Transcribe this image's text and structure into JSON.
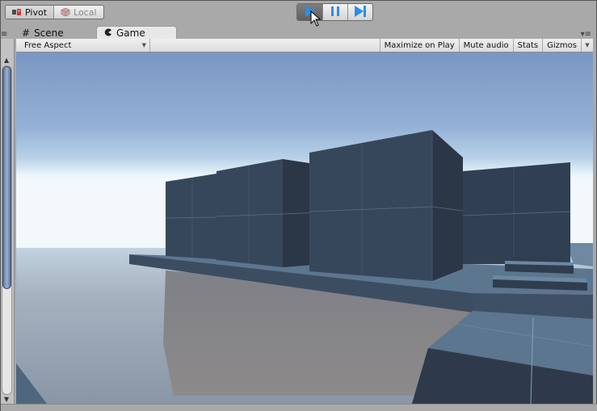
{
  "toolbar": {
    "pivot_label": "Pivot",
    "pivot_icon": "pivot-icon",
    "local_label": "Local",
    "local_icon": "cube-icon",
    "play_icon": "play-icon",
    "pause_icon": "pause-icon",
    "step_icon": "step-icon",
    "play_active": true
  },
  "tabs": [
    {
      "label": "Scene",
      "icon": "grid-icon",
      "active": false
    },
    {
      "label": "Game",
      "icon": "pacman-icon",
      "active": true
    }
  ],
  "tab_menu_glyph": "▾≡",
  "game_toolbar": {
    "aspect": "Free Aspect",
    "maximize_on_play": "Maximize on Play",
    "mute_audio": "Mute audio",
    "stats": "Stats",
    "gizmos": "Gizmos"
  },
  "scrollbar": {
    "up_glyph": "▲",
    "down_glyph": "▼"
  },
  "colors": {
    "play_accent": "#1e90ff",
    "sky_top": "#7b98c4",
    "sky_horizon": "#eef6fb",
    "water": "#8e9aa8",
    "cube_front": "#36465a",
    "cube_side": "#2b3646",
    "platform_top": "#5d7891"
  }
}
